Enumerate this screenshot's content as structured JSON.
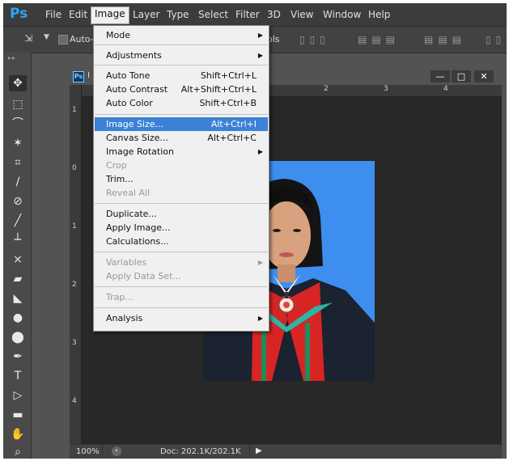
{
  "app": {
    "logo": "Ps",
    "menus": [
      "File",
      "Edit",
      "Image",
      "Layer",
      "Type",
      "Select",
      "Filter",
      "3D",
      "View",
      "Window",
      "Help"
    ],
    "active_menu": "Image"
  },
  "options": {
    "auto_select_label": "Auto-",
    "controls_label": "ols"
  },
  "image_menu": {
    "mode": "Mode",
    "adjustments": "Adjustments",
    "auto_tone": "Auto Tone",
    "auto_tone_sc": "Shift+Ctrl+L",
    "auto_contrast": "Auto Contrast",
    "auto_contrast_sc": "Alt+Shift+Ctrl+L",
    "auto_color": "Auto Color",
    "auto_color_sc": "Shift+Ctrl+B",
    "image_size": "Image Size...",
    "image_size_sc": "Alt+Ctrl+I",
    "canvas_size": "Canvas Size...",
    "canvas_size_sc": "Alt+Ctrl+C",
    "image_rotation": "Image Rotation",
    "crop": "Crop",
    "trim": "Trim...",
    "reveal_all": "Reveal All",
    "duplicate": "Duplicate...",
    "apply_image": "Apply Image...",
    "calculations": "Calculations...",
    "variables": "Variables",
    "apply_data_set": "Apply Data Set...",
    "trap": "Trap...",
    "analysis": "Analysis"
  },
  "document": {
    "tab_icon": "Ps",
    "tab_label": "I",
    "window_minimize": "—",
    "window_restore": "□",
    "window_close": "✕",
    "ruler_top": [
      "2",
      "3",
      "4"
    ],
    "ruler_left": [
      "1",
      "0",
      "1",
      "2",
      "3",
      "4"
    ],
    "zoom": "100%",
    "doc_size": "Doc: 202.1K/202.1K"
  }
}
